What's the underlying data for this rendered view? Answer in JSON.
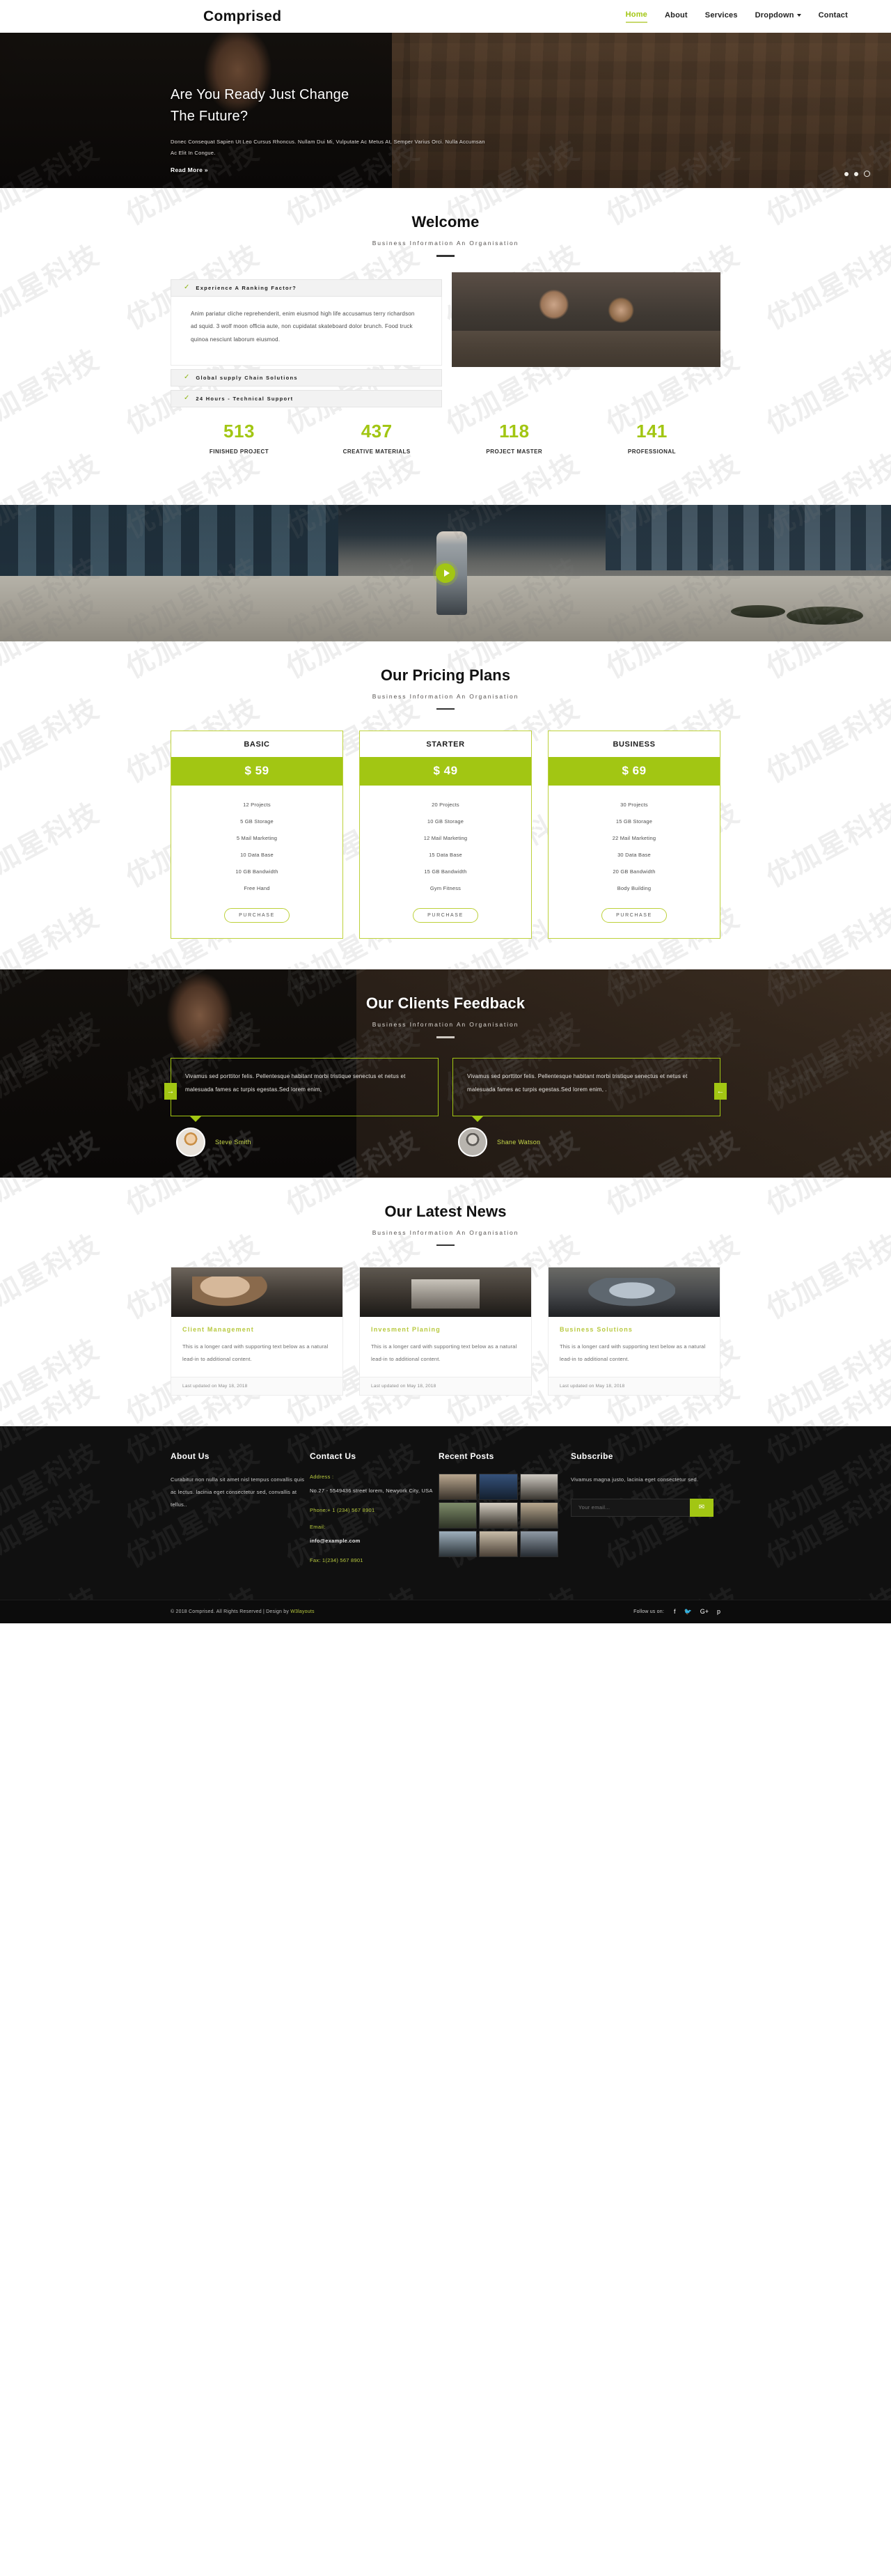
{
  "brand": "Comprised",
  "nav": {
    "items": [
      {
        "label": "Home",
        "active": true
      },
      {
        "label": "About",
        "active": false
      },
      {
        "label": "Services",
        "active": false
      },
      {
        "label": "Dropdown",
        "active": false,
        "caret": true
      },
      {
        "label": "Contact",
        "active": false
      }
    ]
  },
  "hero": {
    "title_line1": "Are You Ready Just Change",
    "title_line2": "The Future?",
    "paragraph": "Donec Consequat Sapien Ut Leo Cursus Rhoncus. Nullam Dui Mi, Vulputate Ac Metus At, Semper Varius Orci. Nulla Accumsan Ac Elit In Congue.",
    "cta": "Read More »",
    "slider_dots": 3,
    "active_dot": 3
  },
  "welcome": {
    "title": "Welcome",
    "subtitle": "Business Information An Organisation",
    "accordion": [
      {
        "label": "Experience A Ranking Factor?",
        "open": true,
        "body": "Anim pariatur cliche reprehenderit, enim eiusmod high life accusamus terry richardson ad squid. 3 wolf moon officia aute, non cupidatat skateboard dolor brunch. Food truck quinoa nesciunt laborum eiusmod."
      },
      {
        "label": "Global supply Chain Solutions",
        "open": false,
        "body": ""
      },
      {
        "label": "24 Hours - Technical Support",
        "open": false,
        "body": ""
      }
    ],
    "image_alt": "business-handshake-photo"
  },
  "counters": [
    {
      "num": "513",
      "caption": "FINISHED PROJECT"
    },
    {
      "num": "437",
      "caption": "CREATIVE MATERIALS"
    },
    {
      "num": "118",
      "caption": "PROJECT MASTER"
    },
    {
      "num": "141",
      "caption": "PROFESSIONAL"
    }
  ],
  "video": {
    "play_label": "play-video"
  },
  "pricing": {
    "title": "Our Pricing Plans",
    "subtitle": "Business Information An Organisation",
    "plans": [
      {
        "name": "BASIC",
        "price": "$ 59",
        "features": [
          "12 Projects",
          "5 GB Storage",
          "5 Mail Marketing",
          "10 Data Base",
          "10 GB Bandwidth",
          "Free Hand"
        ],
        "button": "PURCHASE"
      },
      {
        "name": "STARTER",
        "price": "$ 49",
        "features": [
          "20 Projects",
          "10 GB Storage",
          "12 Mail Marketing",
          "15 Data Base",
          "15 GB Bandwidth",
          "Gym Fitness"
        ],
        "button": "PURCHASE"
      },
      {
        "name": "BUSINESS",
        "price": "$ 69",
        "features": [
          "30 Projects",
          "15 GB Storage",
          "22 Mail Marketing",
          "30 Data Base",
          "20 GB Bandwidth",
          "Body Building"
        ],
        "button": "PURCHASE"
      }
    ]
  },
  "testimonials": {
    "title": "Our Clients Feedback",
    "subtitle": "Business Information An Organisation",
    "prev_arrow": "→",
    "next_arrow": "←",
    "items": [
      {
        "quote": "Vivamus sed porttitor felis. Pellentesque habitant morbi tristique senectus et netus et malesuada fames ac turpis egestas.Sed lorem enim,",
        "name": "Steve Smith"
      },
      {
        "quote": "Vivamus sed porttitor felis. Pellentesque habitant morbi tristique senectus et netus et malesuada fames ac turpis egestas.Sed lorem enim, .",
        "name": "Shane Watson"
      }
    ]
  },
  "news": {
    "title": "Our Latest News",
    "subtitle": "Business Information An Organisation",
    "cards": [
      {
        "title": "Client Management",
        "text": "This is a longer card with supporting text below as a natural lead-in to additional content.",
        "meta": "Last updated on May 18, 2018"
      },
      {
        "title": "Invesment Planing",
        "text": "This is a longer card with supporting text below as a natural lead-in to additional content.",
        "meta": "Last updated on May 18, 2018"
      },
      {
        "title": "Business Solutions",
        "text": "This is a longer card with supporting text below as a natural lead-in to additional content.",
        "meta": "Last updated on May 18, 2018"
      }
    ]
  },
  "footer": {
    "about": {
      "title": "About Us",
      "text": "Curabitur non nulla sit amet nisl tempus convallis quis ac lectus. lacinia eget consectetur sed, convallis at tellus.."
    },
    "contact": {
      "title": "Contact Us",
      "address_label": "Address :",
      "address_value": "No.27 - 5549436 street lorem, Newyork City, USA",
      "phone": "Phone:+ 1 (234) 567 8901",
      "email_label": "Email:",
      "email_value": "info@example.com",
      "fax": "Fax: 1(234) 567 8901"
    },
    "recent": {
      "title": "Recent Posts",
      "thumb_count": 9
    },
    "subscribe": {
      "title": "Subscribe",
      "text": "Vivamus magna justo, lacinia eget consectetur sed.",
      "placeholder": "Your email...",
      "button_icon": "✉"
    },
    "copyright_prefix": "© 2018 Comprised. All Rights Reserved | Design by ",
    "copyright_link": "W3layouts",
    "follow_label": "Follow us on:",
    "socials": [
      {
        "name": "facebook-icon",
        "glyph": "f"
      },
      {
        "name": "twitter-icon",
        "glyph": "🐦"
      },
      {
        "name": "google-plus-icon",
        "glyph": "G+"
      },
      {
        "name": "pinterest-icon",
        "glyph": "р"
      }
    ]
  },
  "watermark": {
    "text": "优加星科技"
  },
  "colors": {
    "accent": "#a2c613",
    "accent_light": "#bdd13a",
    "dark": "#101010"
  }
}
